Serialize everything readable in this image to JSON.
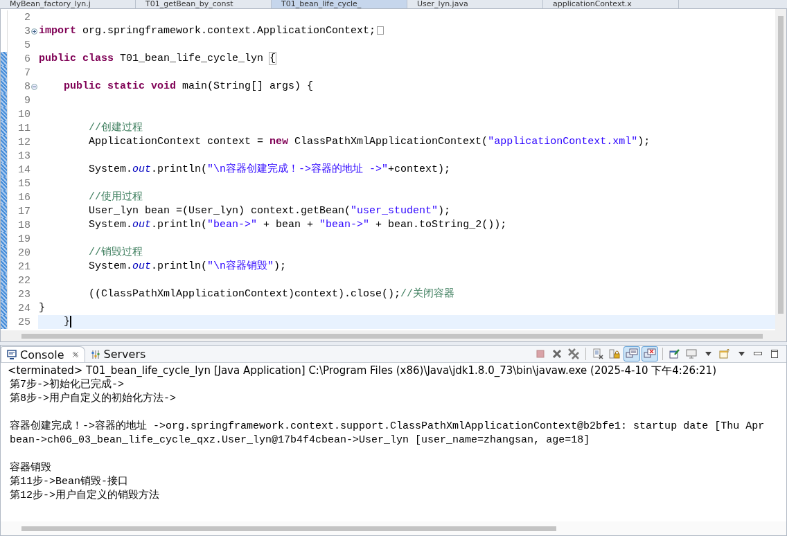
{
  "editor_tabs": [
    {
      "label": "MyBean_factory_lyn.j",
      "selected": false
    },
    {
      "label": "T01_getBean_by_const",
      "selected": false
    },
    {
      "label": "T01_bean_life_cycle_",
      "selected": true
    },
    {
      "label": "User_lyn.java",
      "selected": false
    },
    {
      "label": "applicationContext.x",
      "selected": false
    }
  ],
  "code_lines": [
    {
      "number": "2",
      "kind": "code",
      "changed": false,
      "current": false
    },
    {
      "number": "3",
      "kind": "collapsed",
      "changed": false,
      "current": false,
      "segments": [
        {
          "kind": "keyword",
          "text": "import"
        },
        {
          "kind": "plain",
          "text": " org.springframework.context.ApplicationContext;"
        },
        {
          "kind": "folded"
        }
      ]
    },
    {
      "number": "5",
      "kind": "code",
      "changed": false,
      "current": false
    },
    {
      "number": "6",
      "kind": "code",
      "changed": true,
      "current": false,
      "segments": [
        {
          "kind": "keyword",
          "text": "public class"
        },
        {
          "kind": "plain",
          "text": " T01_bean_life_cycle_lyn "
        },
        {
          "kind": "bracket",
          "text": "{"
        }
      ]
    },
    {
      "number": "7",
      "kind": "code",
      "changed": true,
      "current": false
    },
    {
      "number": "8",
      "kind": "expanded",
      "changed": true,
      "current": false,
      "segments": [
        {
          "kind": "keyword",
          "text": "    public static void"
        },
        {
          "kind": "plain",
          "text": " main(String[] args) {"
        }
      ]
    },
    {
      "number": "9",
      "kind": "code",
      "changed": true,
      "current": false
    },
    {
      "number": "10",
      "kind": "code",
      "changed": true,
      "current": false
    },
    {
      "number": "11",
      "kind": "code",
      "changed": true,
      "current": false,
      "segments": [
        {
          "kind": "comment",
          "text": "        //创建过程"
        }
      ]
    },
    {
      "number": "12",
      "kind": "code",
      "changed": true,
      "current": false,
      "segments": [
        {
          "kind": "plain",
          "text": "        ApplicationContext context = "
        },
        {
          "kind": "keyword",
          "text": "new"
        },
        {
          "kind": "plain",
          "text": " ClassPathXmlApplicationContext("
        },
        {
          "kind": "string",
          "text": "\"applicationContext.xml\""
        },
        {
          "kind": "plain",
          "text": ");"
        }
      ]
    },
    {
      "number": "13",
      "kind": "code",
      "changed": true,
      "current": false
    },
    {
      "number": "14",
      "kind": "code",
      "changed": true,
      "current": false,
      "segments": [
        {
          "kind": "plain",
          "text": "        System."
        },
        {
          "kind": "field",
          "text": "out"
        },
        {
          "kind": "plain",
          "text": ".println("
        },
        {
          "kind": "string",
          "text": "\"\\n容器创建完成！->容器的地址 ->\""
        },
        {
          "kind": "plain",
          "text": "+context);"
        }
      ]
    },
    {
      "number": "15",
      "kind": "code",
      "changed": true,
      "current": false
    },
    {
      "number": "16",
      "kind": "code",
      "changed": true,
      "current": false,
      "segments": [
        {
          "kind": "comment",
          "text": "        //使用过程"
        }
      ]
    },
    {
      "number": "17",
      "kind": "code",
      "changed": true,
      "current": false,
      "segments": [
        {
          "kind": "plain",
          "text": "        User_lyn bean =(User_lyn) context.getBean("
        },
        {
          "kind": "string",
          "text": "\"user_student\""
        },
        {
          "kind": "plain",
          "text": ");"
        }
      ]
    },
    {
      "number": "18",
      "kind": "code",
      "changed": true,
      "current": false,
      "segments": [
        {
          "kind": "plain",
          "text": "        System."
        },
        {
          "kind": "field",
          "text": "out"
        },
        {
          "kind": "plain",
          "text": ".println("
        },
        {
          "kind": "string",
          "text": "\"bean->\""
        },
        {
          "kind": "plain",
          "text": " + bean + "
        },
        {
          "kind": "string",
          "text": "\"bean->\""
        },
        {
          "kind": "plain",
          "text": " + bean.toString_2());"
        }
      ]
    },
    {
      "number": "19",
      "kind": "code",
      "changed": true,
      "current": false
    },
    {
      "number": "20",
      "kind": "code",
      "changed": true,
      "current": false,
      "segments": [
        {
          "kind": "comment",
          "text": "        //销毁过程"
        }
      ]
    },
    {
      "number": "21",
      "kind": "code",
      "changed": true,
      "current": false,
      "segments": [
        {
          "kind": "plain",
          "text": "        System."
        },
        {
          "kind": "field",
          "text": "out"
        },
        {
          "kind": "plain",
          "text": ".println("
        },
        {
          "kind": "string",
          "text": "\"\\n容器销毁\""
        },
        {
          "kind": "plain",
          "text": ");"
        }
      ]
    },
    {
      "number": "22",
      "kind": "code",
      "changed": true,
      "current": false
    },
    {
      "number": "23",
      "kind": "code",
      "changed": true,
      "current": false,
      "segments": [
        {
          "kind": "plain",
          "text": "        ((ClassPathXmlApplicationContext)context).close();"
        },
        {
          "kind": "comment",
          "text": "//关闭容器"
        }
      ]
    },
    {
      "number": "24",
      "kind": "code",
      "changed": true,
      "current": false,
      "segments": [
        {
          "kind": "plain",
          "text": "}"
        }
      ]
    },
    {
      "number": "25",
      "kind": "code",
      "changed": true,
      "current": true,
      "segments": [
        {
          "kind": "plain",
          "text": "    }"
        }
      ]
    }
  ],
  "console": {
    "tabs": [
      {
        "label": "Console",
        "kind": "console",
        "selected": true
      },
      {
        "label": "Servers",
        "kind": "servers",
        "selected": false
      }
    ],
    "toolbar": [
      [
        {
          "kind": "stop",
          "pressed": false
        },
        {
          "kind": "remove",
          "pressed": false
        },
        {
          "kind": "remove-all",
          "pressed": false
        }
      ],
      [
        {
          "kind": "clear",
          "pressed": false
        },
        {
          "kind": "lock",
          "pressed": false
        },
        {
          "kind": "stdout",
          "pressed": true
        },
        {
          "kind": "stderr",
          "pressed": true
        }
      ],
      [
        {
          "kind": "pin",
          "pressed": false
        },
        {
          "kind": "display",
          "pressed": false
        },
        {
          "kind": "caret",
          "pressed": false
        },
        {
          "kind": "open",
          "pressed": false
        },
        {
          "kind": "caret",
          "pressed": false
        },
        {
          "kind": "minimize",
          "pressed": false
        },
        {
          "kind": "maximize",
          "pressed": false
        }
      ]
    ],
    "header": "<terminated> T01_bean_life_cycle_lyn [Java Application] C:\\Program Files (x86)\\Java\\jdk1.8.0_73\\bin\\javaw.exe (2025-4-10 下午4:26:21)",
    "output": [
      [
        "第7步->初始化已完成->",
        "第8步->用户自定义的初始化方法->"
      ],
      [
        "容器创建完成！->容器的地址 ->org.springframework.context.support.ClassPathXmlApplicationContext@b2bfe1: startup date [Thu Apr",
        "bean->ch06_03_bean_life_cycle_qxz.User_lyn@17b4f4cbean->User_lyn [user_name=zhangsan, age=18]"
      ],
      [
        "容器销毁",
        "第11步->Bean销毁-接口",
        "第12步->用户自定义的销毁方法"
      ]
    ]
  }
}
